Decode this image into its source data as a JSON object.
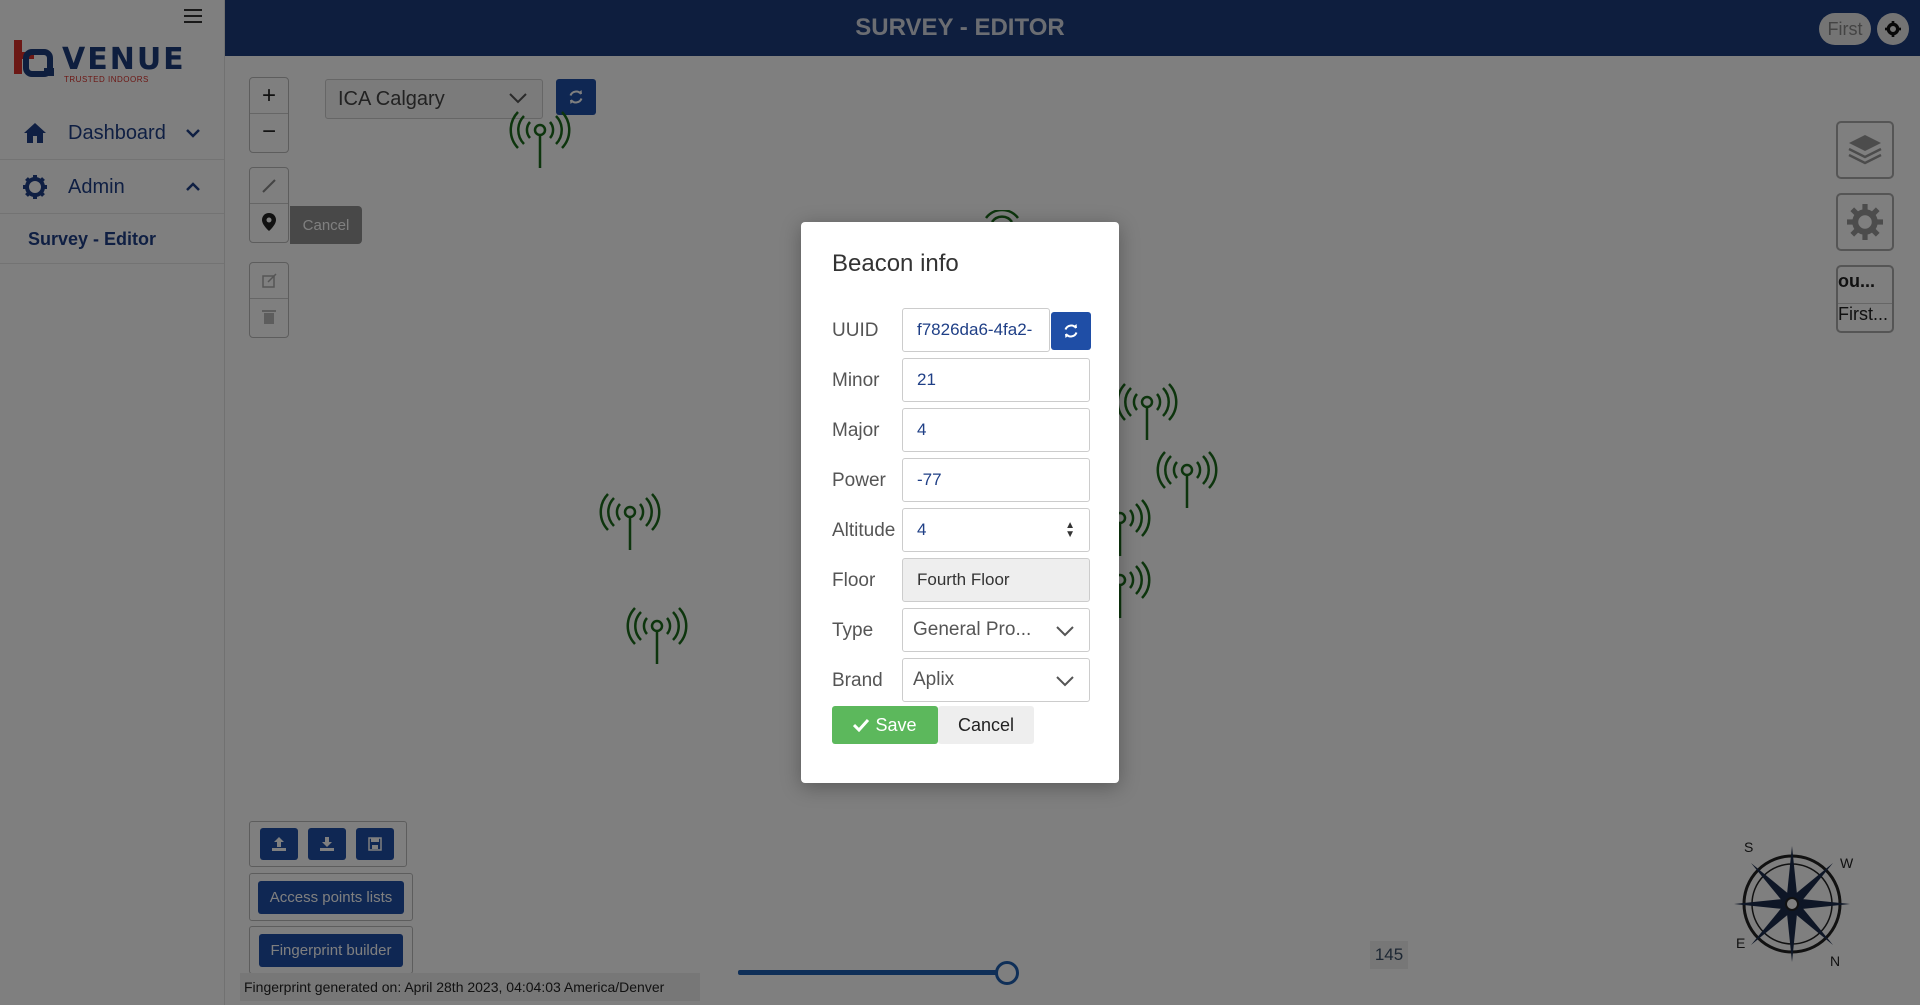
{
  "header": {
    "title": "SURVEY - EDITOR",
    "user": "First"
  },
  "logo": {
    "name": "VENUE",
    "tagline": "TRUSTED INDOORS"
  },
  "sidebar": {
    "items": [
      {
        "label": "Dashboard",
        "icon": "home-icon",
        "expanded": false
      },
      {
        "label": "Admin",
        "icon": "gear-icon",
        "expanded": true
      }
    ],
    "sub_item": "Survey - Editor"
  },
  "map": {
    "venue_select": "ICA Calgary",
    "cancel_tooltip": "Cancel",
    "floor_card": {
      "line1": "ou...",
      "line2": "First..."
    },
    "access_points_button": "Access points lists",
    "fingerprint_builder_button": "Fingerprint builder",
    "fingerprint_note": "Fingerprint generated on: April 28th 2023, 04:04:03 America/Denver",
    "slider_value": "145",
    "compass_labels": {
      "s": "S",
      "w": "W",
      "e": "E",
      "n": "N"
    }
  },
  "modal": {
    "title": "Beacon info",
    "fields": {
      "uuid": {
        "label": "UUID",
        "value": "f7826da6-4fa2-"
      },
      "minor": {
        "label": "Minor",
        "value": "21"
      },
      "major": {
        "label": "Major",
        "value": "4"
      },
      "power": {
        "label": "Power",
        "value": "-77"
      },
      "altitude": {
        "label": "Altitude",
        "value": "4"
      },
      "floor": {
        "label": "Floor",
        "value": "Fourth Floor"
      },
      "type": {
        "label": "Type",
        "value": "General Pro..."
      },
      "brand": {
        "label": "Brand",
        "value": "Aplix"
      }
    },
    "save_label": "Save",
    "cancel_label": "Cancel"
  },
  "colors": {
    "primary": "#1c3d7d",
    "accent": "#1f4ea6",
    "success": "#5cb85c",
    "beacon": "#1a6b1a"
  }
}
